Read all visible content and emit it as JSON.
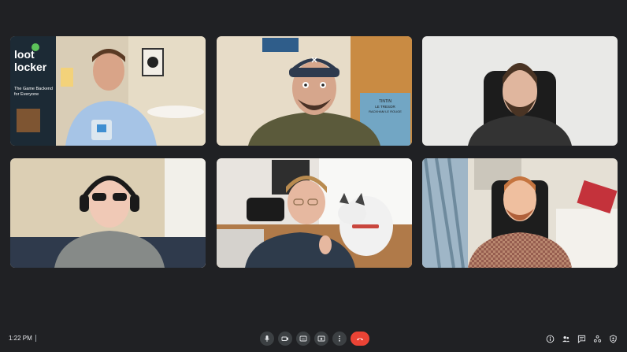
{
  "meeting": {
    "time": "1:22 PM"
  },
  "tiles": [
    {
      "id": "participant-1",
      "logo_text_line1": "loot",
      "logo_text_line2": "locker",
      "tagline_line1": "The Game Backend",
      "tagline_line2": "for Everyone"
    },
    {
      "id": "participant-2",
      "book_text_line1": "TINTIN",
      "book_text_line2": "LE TRESOR",
      "book_text_line3": "RACKHAM LE ROUGE"
    },
    {
      "id": "participant-3"
    },
    {
      "id": "participant-4"
    },
    {
      "id": "participant-5"
    },
    {
      "id": "participant-6"
    }
  ],
  "controls": [
    {
      "name": "microphone",
      "icon": "microphone-icon"
    },
    {
      "name": "camera",
      "icon": "camera-icon"
    },
    {
      "name": "captions",
      "icon": "captions-icon"
    },
    {
      "name": "present",
      "icon": "present-icon"
    },
    {
      "name": "more-options",
      "icon": "more-vert-icon"
    },
    {
      "name": "leave-call",
      "icon": "hang-up-icon",
      "color": "#ea4335"
    }
  ],
  "side_controls": [
    {
      "name": "meeting-details",
      "icon": "info-icon"
    },
    {
      "name": "people",
      "icon": "people-icon"
    },
    {
      "name": "chat",
      "icon": "chat-icon"
    },
    {
      "name": "activities",
      "icon": "activities-icon"
    },
    {
      "name": "host-controls",
      "icon": "shield-icon"
    }
  ],
  "colors": {
    "background": "#202124",
    "control_bg": "#3c4043",
    "end_call": "#ea4335"
  }
}
